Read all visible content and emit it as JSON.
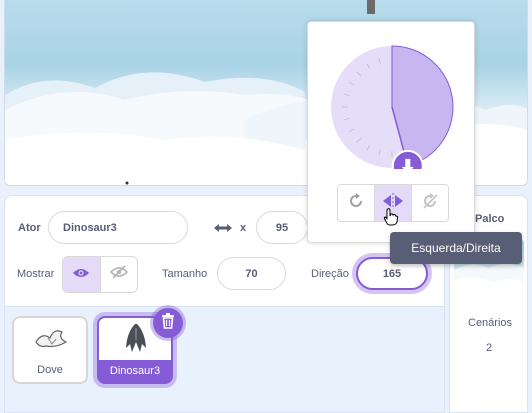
{
  "sprite_info": {
    "sprite_label": "Ator",
    "sprite_name": "Dinosaur3",
    "x_label": "x",
    "x_value": "95",
    "show_label": "Mostrar",
    "size_label": "Tamanho",
    "size_value": "70",
    "direction_label": "Direção",
    "direction_value": "165"
  },
  "direction_dial": {
    "direction_degrees": 165,
    "rotation_modes": [
      "all-around",
      "left-right",
      "dont-rotate"
    ],
    "active_mode": "left-right",
    "tooltip": "Esquerda/Direita"
  },
  "sprites": [
    {
      "name": "Dove",
      "selected": false
    },
    {
      "name": "Dinosaur3",
      "selected": true
    }
  ],
  "stage_pane": {
    "title": "Palco",
    "backdrops_label": "Cenários",
    "backdrops_count": "2"
  },
  "colors": {
    "accent": "#855cd6",
    "accent_light": "#e3dbf7",
    "text": "#575e75",
    "tooltip_bg": "#575e75"
  }
}
